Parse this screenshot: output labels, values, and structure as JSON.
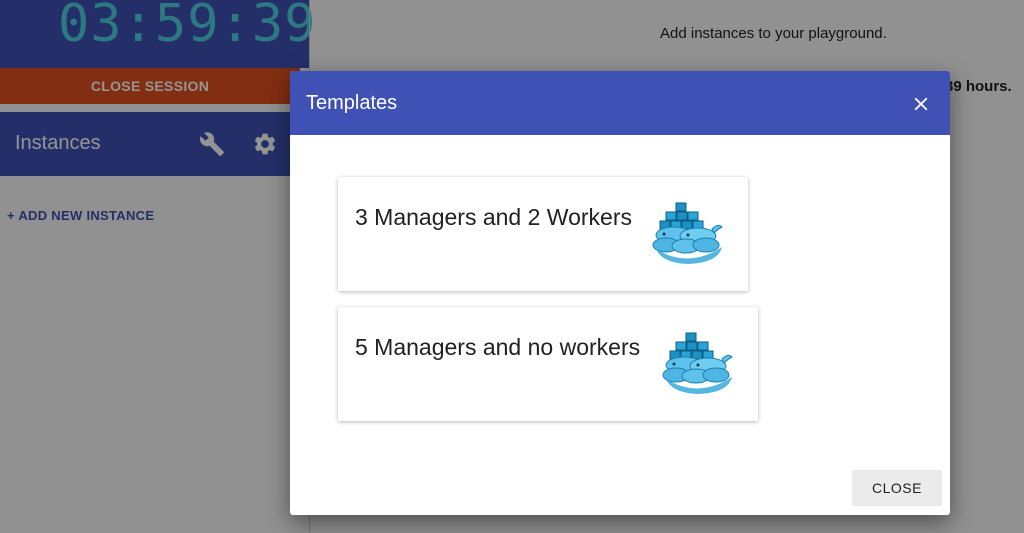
{
  "sidebar": {
    "timer": "03:59:39",
    "close_session_label": "CLOSE SESSION",
    "instances_title": "Instances",
    "tool_icons": [
      "wrench-icon",
      "gear-icon"
    ],
    "add_instance_label": "+ ADD NEW INSTANCE"
  },
  "main": {
    "hint": "Add instances to your playground.",
    "hours_fragment": ":39 hours."
  },
  "dialog": {
    "title": "Templates",
    "close_icon": "close-icon",
    "templates": [
      {
        "label": "3 Managers and 2 Workers",
        "icon": "docker-whale-icon"
      },
      {
        "label": "5 Managers and no workers",
        "icon": "docker-whale-icon"
      }
    ],
    "close_button_label": "CLOSE"
  },
  "colors": {
    "primary": "#3f51b5",
    "accent_orange": "#e0501f",
    "timer_cyan": "#4dd0e1",
    "overlay": "rgba(0,0,0,0.42)"
  }
}
